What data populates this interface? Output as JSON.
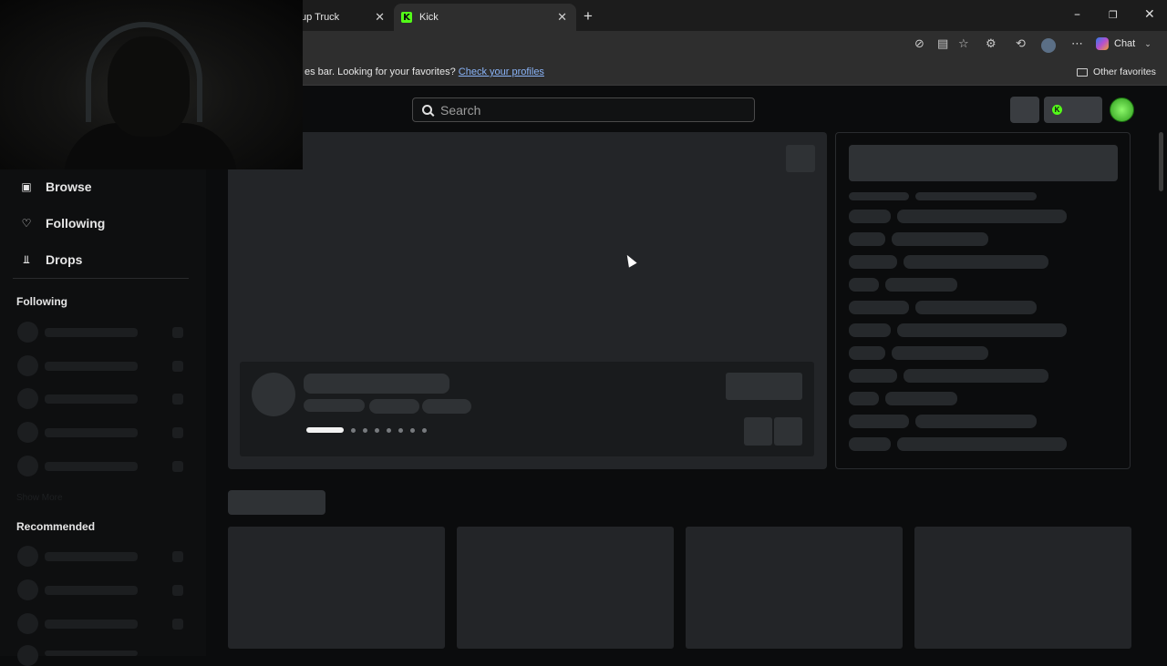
{
  "browser": {
    "tabs": [
      {
        "label": "up Truck"
      },
      {
        "label": "Kick",
        "logo": "K"
      }
    ],
    "favorites_message": "es bar. Looking for your favorites?",
    "favorites_link": "Check your profiles",
    "other_favorites": "Other favorites",
    "chat_label": "Chat"
  },
  "page": {
    "search_placeholder": "Search",
    "nav": [
      {
        "label": "Browse",
        "icon": "browse-icon"
      },
      {
        "label": "Following",
        "icon": "heart-icon"
      },
      {
        "label": "Drops",
        "icon": "drops-icon"
      }
    ],
    "sections": {
      "following": "Following",
      "show_more": "Show More",
      "recommended": "Recommended"
    }
  },
  "colors": {
    "brand": "#53fc18",
    "background": "#0b0c0d",
    "skeleton": "#232528",
    "link": "#8ab4f8"
  }
}
